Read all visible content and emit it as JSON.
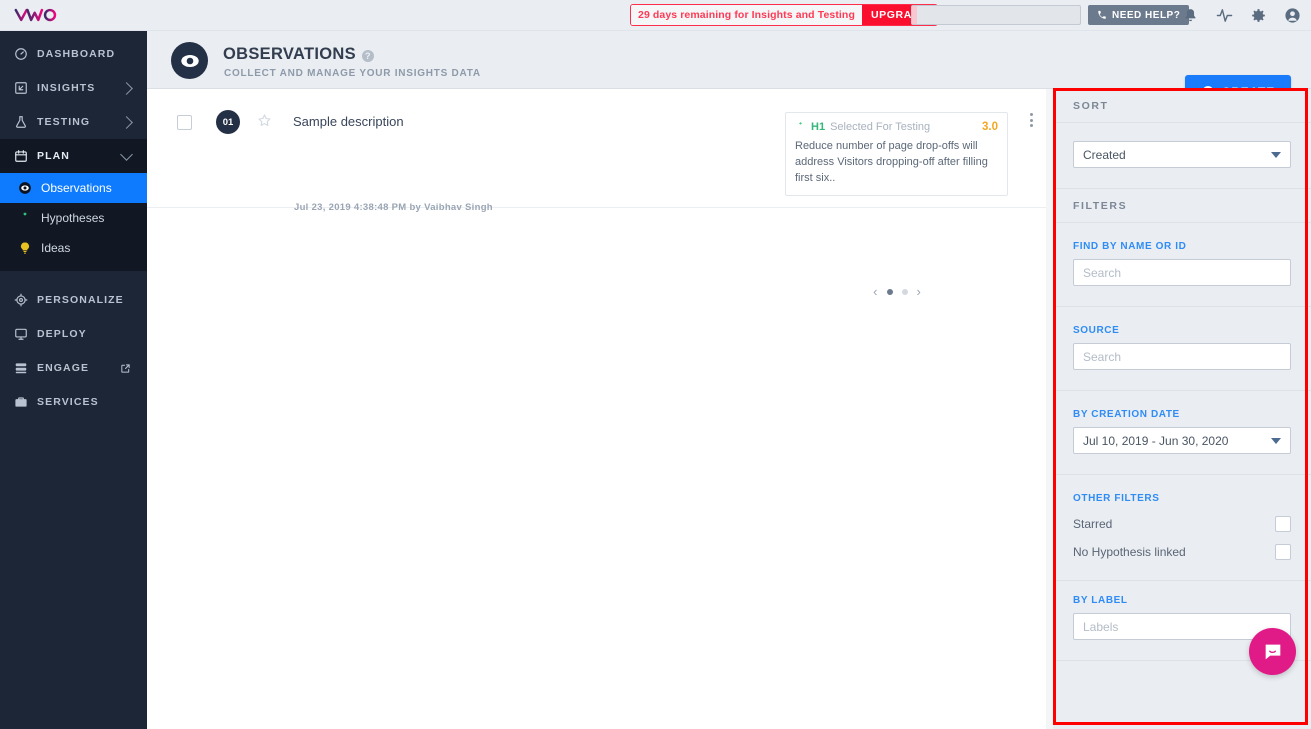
{
  "topbar": {
    "logo_alt": "VWO",
    "trial_text": "29 days remaining for Insights and Testing",
    "upgrade_label": "UPGRADE",
    "need_help_label": "NEED HELP?",
    "icons": [
      "bell-icon",
      "pulse-icon",
      "gear-icon",
      "account-icon"
    ],
    "usage_percent": 3
  },
  "sidebar": {
    "items": [
      {
        "label": "DASHBOARD",
        "icon": "dashboard-icon",
        "chevron": "none"
      },
      {
        "label": "INSIGHTS",
        "icon": "insights-icon",
        "chevron": "right"
      },
      {
        "label": "TESTING",
        "icon": "flask-icon",
        "chevron": "right"
      },
      {
        "label": "PLAN",
        "icon": "calendar-icon",
        "chevron": "down"
      }
    ],
    "plan_children": [
      {
        "label": "Observations",
        "icon": "eye-icon",
        "active": true
      },
      {
        "label": "Hypotheses",
        "icon": "hypothesis-icon",
        "active": false
      },
      {
        "label": "Ideas",
        "icon": "bulb-icon",
        "active": false
      }
    ],
    "lower_items": [
      {
        "label": "PERSONALIZE",
        "icon": "target-icon",
        "external": false
      },
      {
        "label": "DEPLOY",
        "icon": "deploy-icon",
        "external": false
      },
      {
        "label": "ENGAGE",
        "icon": "engage-icon",
        "external": true
      },
      {
        "label": "SERVICES",
        "icon": "briefcase-icon",
        "external": false
      }
    ]
  },
  "header": {
    "badge_icon": "eye-icon",
    "title": "OBSERVATIONS",
    "help_glyph": "?",
    "subtitle": "COLLECT AND MANAGE YOUR INSIGHTS DATA",
    "create_label": "CREATE"
  },
  "list": {
    "rows": [
      {
        "number": "01",
        "description": "Sample description",
        "meta": "Jul 23, 2019 4:38:48 PM by Vaibhav Singh",
        "starred": false,
        "hypothesis": {
          "id": "H1",
          "status": "Selected For Testing",
          "score": "3.0",
          "text": "Reduce number of page drop-offs will address Visitors dropping-off after filling first six.."
        },
        "pager": {
          "prev": "‹",
          "next": "›",
          "dots": 2,
          "active_dot": 0
        }
      }
    ]
  },
  "filters": {
    "sort_heading": "SORT",
    "sort_value": "Created",
    "filters_heading": "FILTERS",
    "find_label": "FIND BY NAME OR ID",
    "find_placeholder": "Search",
    "source_label": "SOURCE",
    "source_placeholder": "Search",
    "date_label": "BY CREATION DATE",
    "date_value": "Jul 10, 2019 - Jun 30, 2020",
    "other_label": "OTHER FILTERS",
    "other_options": [
      {
        "label": "Starred",
        "checked": false
      },
      {
        "label": "No Hypothesis linked",
        "checked": false
      }
    ],
    "label_label": "BY LABEL",
    "label_placeholder": "Labels",
    "highlight_color": "#ff0000"
  },
  "chat": {
    "icon": "chat-icon",
    "color": "#e01a86"
  }
}
